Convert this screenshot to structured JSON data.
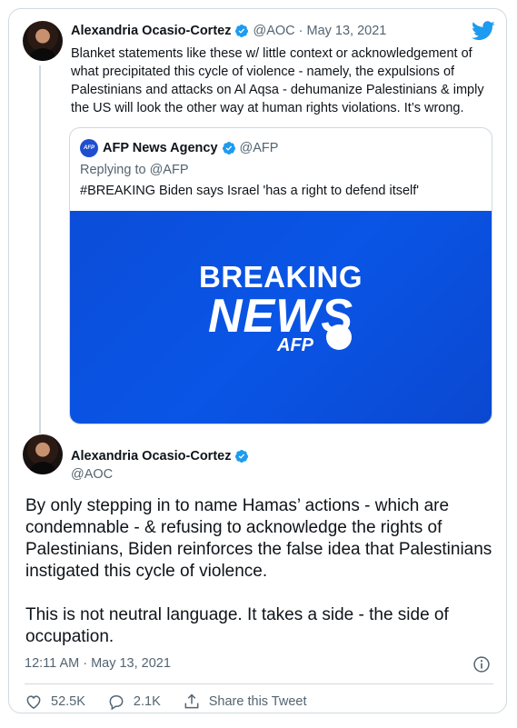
{
  "reply": {
    "author_name": "Alexandria Ocasio-Cortez",
    "handle": "@AOC",
    "date_sep": "·",
    "date": "May 13, 2021",
    "text": "Blanket statements like these w/ little context or acknowledgement of what precipitated this cycle of violence - namely, the expulsions of Palestinians and attacks on Al Aqsa - dehumanize Palestinians & imply the US will look the other way at human rights violations. It’s wrong."
  },
  "quoted": {
    "author_name": "AFP News Agency",
    "handle": "@AFP",
    "avatar_label": "AFP",
    "replying_prefix": "Replying to",
    "replying_to": "@AFP",
    "text": "#BREAKING Biden says Israel 'has a right to defend itself'",
    "media": {
      "line1": "BREAKING",
      "line2": "NEWS",
      "brand": "AFP"
    }
  },
  "main": {
    "author_name": "Alexandria Ocasio-Cortez",
    "handle": "@AOC",
    "paragraphs": [
      "By only stepping in to name Hamas’ actions - which are condemnable - & refusing to acknowledge the rights of Palestinians, Biden reinforces the false idea that Palestinians instigated this cycle of violence.",
      "This is not neutral language. It takes a side - the side of occupation."
    ],
    "timestamp": "12:11 AM · May 13, 2021"
  },
  "actions": {
    "likes": "52.5K",
    "replies": "2.1K",
    "share_label": "Share this Tweet"
  },
  "colors": {
    "accent": "#1d9bf0",
    "muted": "#536471",
    "border": "#cfd9de",
    "media_blue": "#0b4dd8"
  },
  "icons": [
    "twitter-logo-icon",
    "verified-badge-icon",
    "info-icon",
    "heart-icon",
    "reply-icon",
    "share-icon"
  ]
}
